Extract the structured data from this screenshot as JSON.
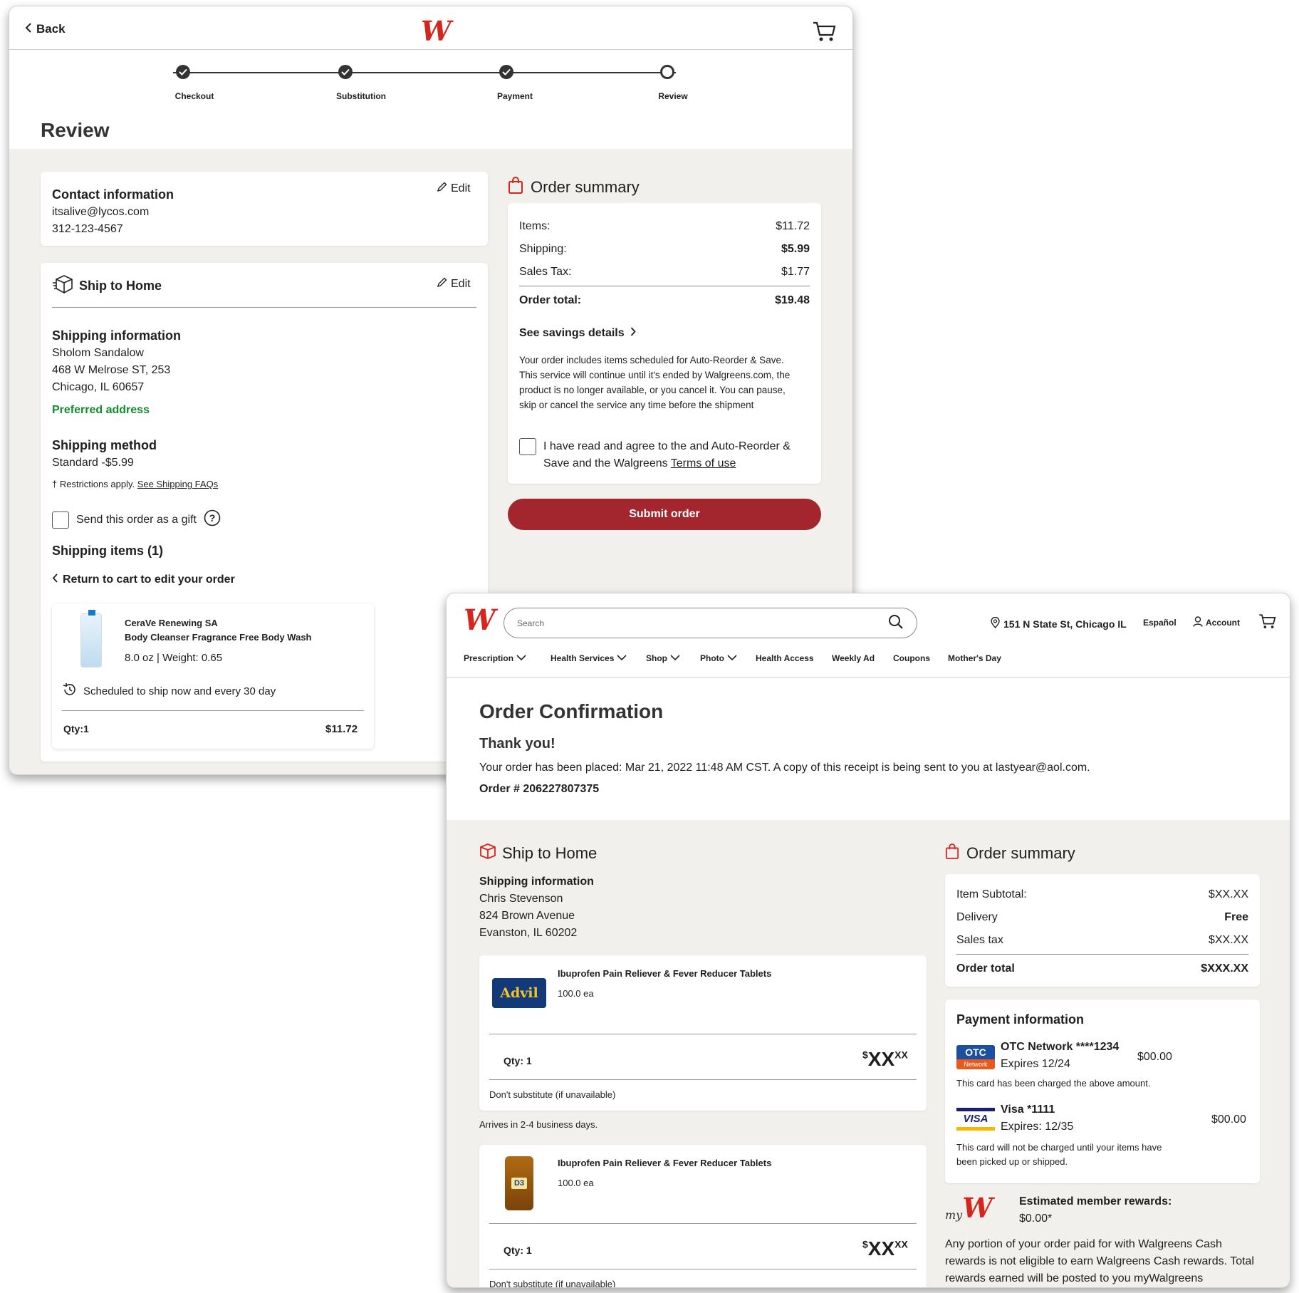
{
  "review": {
    "back_label": "Back",
    "logo": "W",
    "steps": [
      "Checkout",
      "Substitution",
      "Payment",
      "Review"
    ],
    "title": "Review",
    "contact": {
      "heading": "Contact information",
      "email": "itsalive@lycos.com",
      "phone": "312-123-4567",
      "edit": "Edit"
    },
    "ship": {
      "heading": "Ship to Home",
      "edit": "Edit",
      "info_heading": "Shipping information",
      "name": "Sholom Sandalow",
      "street": "468 W Melrose ST, 253",
      "city": "Chicago, IL 60657",
      "preferred": "Preferred address",
      "method_heading": "Shipping method",
      "method": "Standard -$5.99",
      "restrictions": "† Restrictions apply.",
      "faq_link": "See Shipping FAQs",
      "gift_label": "Send this order as a gift",
      "items_heading": "Shipping items (1)",
      "return_link": "Return to cart to edit your order",
      "item": {
        "brand": "CeraVe Renewing SA",
        "name": "Body Cleanser Fragrance Free Body Wash",
        "size": "8.0 oz | Weight: 0.65",
        "schedule": "Scheduled to ship now and every 30 day",
        "qty": "Qty:1",
        "price": "$11.72"
      }
    },
    "summary": {
      "heading": "Order summary",
      "rows": [
        {
          "label": "Items:",
          "value": "$11.72"
        },
        {
          "label": "Shipping:",
          "value": "$5.99"
        },
        {
          "label": "Sales Tax:",
          "value": "$1.77"
        }
      ],
      "total_label": "Order total:",
      "total_value": "$19.48",
      "savings_link": "See savings details",
      "notice": "Your order includes items scheduled for Auto-Reorder & Save. This service will continue until it's ended by Walgreens.com, the product is no longer available, or you cancel it. You can pause, skip or cancel the service any time before the shipment",
      "agree_pre": "I have read and agree to the and Auto-Reorder & Save and the Walgreens",
      "terms_link": "Terms of use",
      "submit": "Submit order"
    }
  },
  "confirm": {
    "search_placeholder": "Search",
    "location": "151 N State St, Chicago IL",
    "lang": "Español",
    "account": "Account",
    "nav": [
      "Prescription",
      "Health Services",
      "Shop",
      "Photo",
      "Health Access",
      "Weekly Ad",
      "Coupons",
      "Mother's Day"
    ],
    "title": "Order Confirmation",
    "thanks": "Thank you!",
    "placed": "Your order has been placed: Mar 21, 2022 11:48 AM CST. A copy of this receipt is being sent to you at lastyear@aol.com.",
    "order_no": "Order # 206227807375",
    "ship": {
      "heading": "Ship to Home",
      "info_heading": "Shipping information",
      "name": "Chris Stevenson",
      "street": "824 Brown Avenue",
      "city": "Evanston, IL 60202",
      "items": [
        {
          "name": "Ibuprofen Pain Reliever & Fever Reducer Tablets",
          "size": "100.0 ea",
          "qty": "Qty: 1",
          "price": "XX",
          "cents": "XX",
          "sub": "Don't substitute (if unavailable)",
          "img_text": "Advil"
        },
        {
          "name": "Ibuprofen Pain Reliever & Fever Reducer Tablets",
          "size": "100.0 ea",
          "qty": "Qty: 1",
          "price": "XX",
          "cents": "XX",
          "sub": "Don't substitute (if unavailable)",
          "img_text": "D3"
        }
      ],
      "arrives": "Arrives in  2-4 business days."
    },
    "summary": {
      "heading": "Order summary",
      "rows": [
        {
          "label": "Item Subtotal:",
          "value": "$XX.XX"
        },
        {
          "label": "Delivery",
          "value": "Free"
        },
        {
          "label": "Sales tax",
          "value": "$XX.XX"
        }
      ],
      "total_label": "Order total",
      "total_value": "$XXX.XX"
    },
    "payment": {
      "heading": "Payment information",
      "otc": {
        "badge_top": "OTC",
        "badge_bottom": "Network",
        "name": "OTC Network ****1234",
        "exp": "Expires 12/24",
        "amount": "$00.00",
        "note": "This card has been charged the above amount."
      },
      "visa": {
        "badge": "VISA",
        "name": "Visa *1111",
        "exp": "Expires: 12/35",
        "amount": "$00.00",
        "note": "This card will not be charged until your items have been picked up or shipped."
      }
    },
    "rewards": {
      "logo_prefix": "my",
      "heading": "Estimated member rewards:",
      "value": "$0.00*",
      "note": "Any portion of your order paid for with Walgreens Cash rewards is not eligible to earn Walgreens Cash rewards. Total rewards earned will be posted to you myWalgreens"
    }
  },
  "colors": {
    "brand_red": "#d4261e",
    "submit": "#a3262f",
    "green": "#138a2e",
    "bg": "#f2f0ec"
  }
}
